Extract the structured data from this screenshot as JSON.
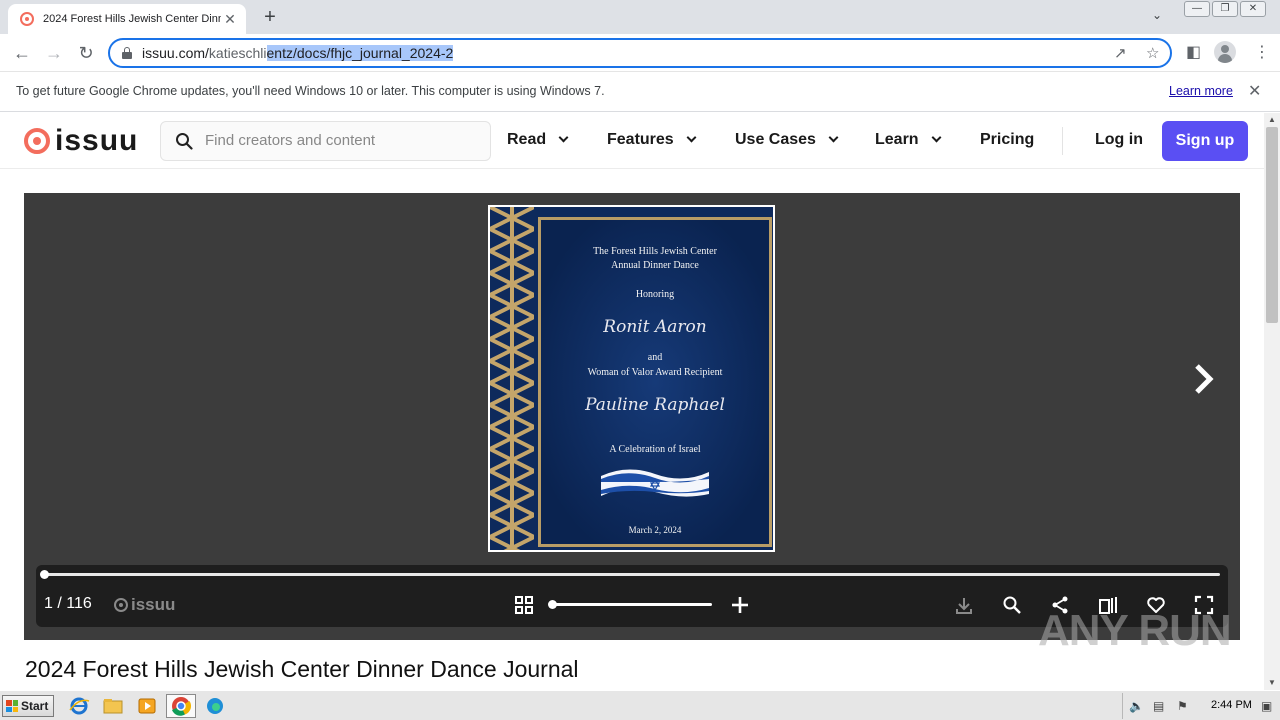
{
  "browser": {
    "tab_title": "2024 Forest Hills Jewish Center Dinn",
    "url_prefix": "issuu.com/",
    "url_dim": "katieschli",
    "url_selected": "entz/docs/fhjc_journal_2024-2"
  },
  "infobar": {
    "message": "To get future Google Chrome updates, you'll need Windows 10 or later. This computer is using Windows 7.",
    "link": "Learn more"
  },
  "header": {
    "logo": "issuu",
    "search_placeholder": "Find creators and content",
    "menu": [
      "Read",
      "Features",
      "Use Cases",
      "Learn",
      "Pricing"
    ],
    "login": "Log in",
    "signup": "Sign up"
  },
  "document": {
    "cover": {
      "line1": "The Forest Hills Jewish Center",
      "line2": "Annual Dinner Dance",
      "honoring": "Honoring",
      "honoree1": "Ronit Aaron",
      "and": "and",
      "award": "Woman of Valor Award Recipient",
      "honoree2": "Pauline Raphael",
      "celebration": "A Celebration of Israel",
      "date": "March 2, 2024"
    },
    "page_counter": "1 / 116",
    "reader_logo": "issuu",
    "progress": 0.0,
    "zoom_level": 0.0,
    "title": "2024 Forest Hills Jewish Center Dinner Dance Journal"
  },
  "watermark": "ANY RUN",
  "taskbar": {
    "start": "Start",
    "clock": "2:44 PM"
  },
  "colors": {
    "issuu_brand": "#f36d5d",
    "signup_bg": "#5a4ff3",
    "reader_bg": "#3c3c3c",
    "cover_navy": "#0e2a5c",
    "cover_gold": "#b99d66"
  }
}
